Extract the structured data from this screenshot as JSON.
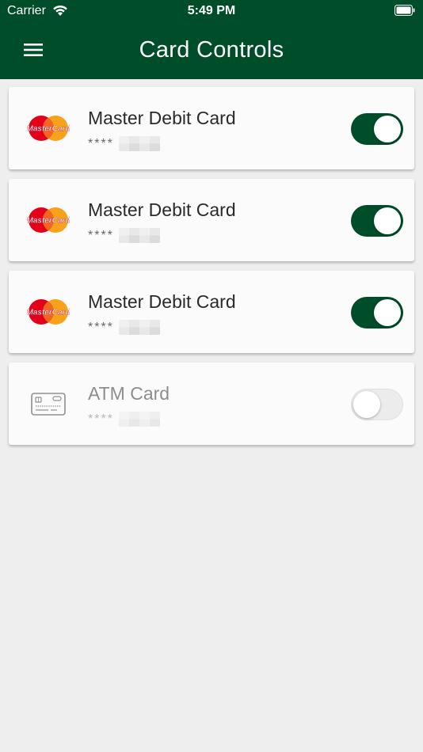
{
  "status_bar": {
    "carrier": "Carrier",
    "time": "5:49 PM"
  },
  "header": {
    "title": "Card Controls",
    "menu_icon": "hamburger-menu-icon"
  },
  "colors": {
    "header_bg": "#004d29",
    "toggle_on": "#004d29",
    "background": "#eeeeee"
  },
  "cards": [
    {
      "name": "Master Debit Card",
      "masked_number": "****",
      "icon": "mastercard-logo-icon",
      "enabled": true
    },
    {
      "name": "Master Debit Card",
      "masked_number": "****",
      "icon": "mastercard-logo-icon",
      "enabled": true
    },
    {
      "name": "Master Debit Card",
      "masked_number": "****",
      "icon": "mastercard-logo-icon",
      "enabled": true
    },
    {
      "name": "ATM Card",
      "masked_number": "****",
      "icon": "atm-card-icon",
      "enabled": false
    }
  ]
}
